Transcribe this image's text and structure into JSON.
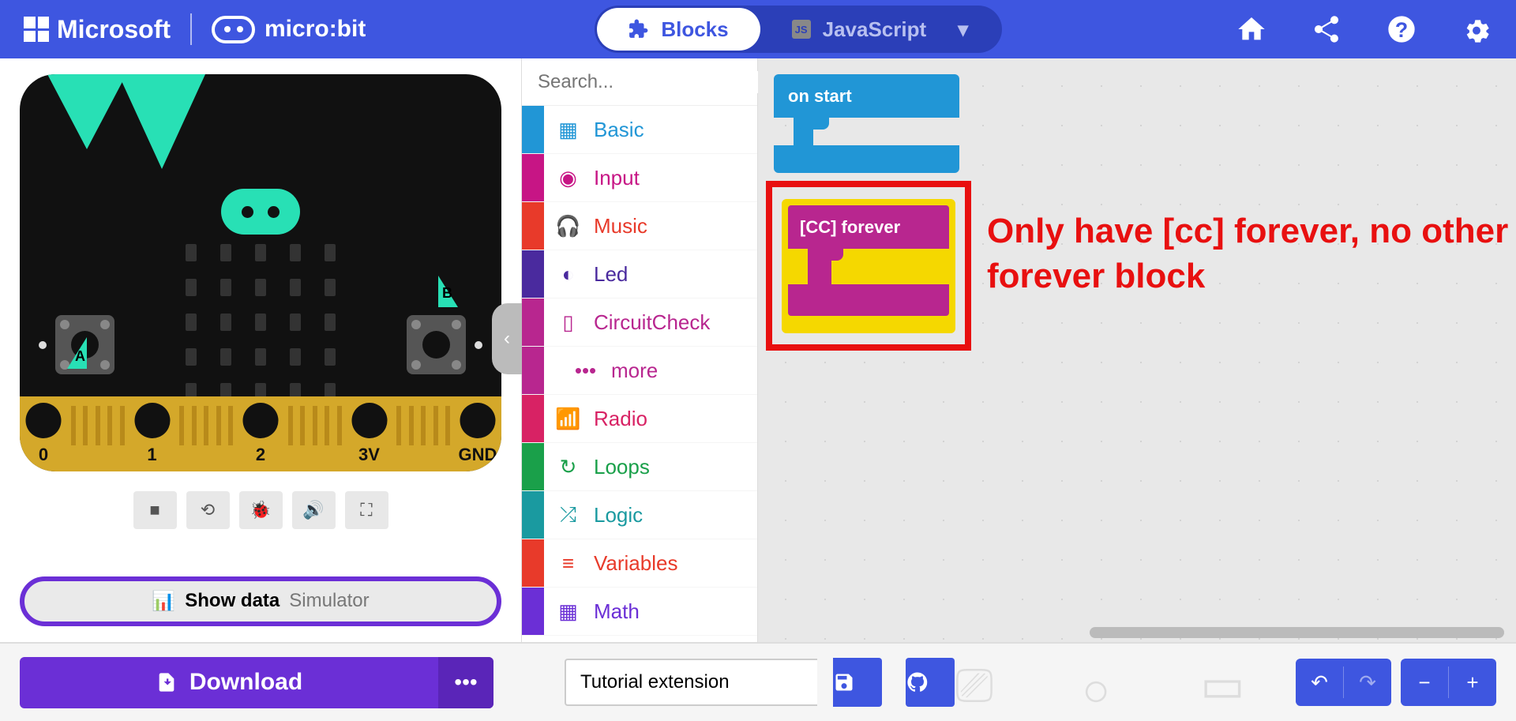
{
  "header": {
    "msLabel": "Microsoft",
    "mbLabel": "micro:bit",
    "tabBlocks": "Blocks",
    "tabJs": "JavaScript"
  },
  "sim": {
    "pin0": "0",
    "pin1": "1",
    "pin2": "2",
    "pin3v": "3V",
    "pinGnd": "GND",
    "labelA": "A",
    "labelB": "B",
    "showDataLabel": "Show data",
    "showDataSub": "Simulator"
  },
  "search": {
    "placeholder": "Search..."
  },
  "categories": [
    {
      "label": "Basic",
      "color": "#2196d6",
      "text": "#2196d6",
      "icon": "grid"
    },
    {
      "label": "Input",
      "color": "#c71585",
      "text": "#c71585",
      "icon": "circle"
    },
    {
      "label": "Music",
      "color": "#e83a2a",
      "text": "#e83a2a",
      "icon": "headphones"
    },
    {
      "label": "Led",
      "color": "#4a2a9e",
      "text": "#4a2a9e",
      "icon": "toggle"
    },
    {
      "label": "CircuitCheck",
      "color": "#b8268f",
      "text": "#b8268f",
      "icon": "chip"
    },
    {
      "label": "more",
      "color": "#b8268f",
      "text": "#b8268f",
      "icon": "dots",
      "indent": true
    },
    {
      "label": "Radio",
      "color": "#d82264",
      "text": "#d82264",
      "icon": "signal"
    },
    {
      "label": "Loops",
      "color": "#1aa04a",
      "text": "#1aa04a",
      "icon": "redo"
    },
    {
      "label": "Logic",
      "color": "#1a9aa0",
      "text": "#1a9aa0",
      "icon": "shuffle"
    },
    {
      "label": "Variables",
      "color": "#e83a2a",
      "text": "#e83a2a",
      "icon": "list"
    },
    {
      "label": "Math",
      "color": "#6b2fd6",
      "text": "#6b2fd6",
      "icon": "calc"
    }
  ],
  "blocks": {
    "onStart": "on start",
    "ccForever": "[CC] forever"
  },
  "annotation": "Only have [cc] forever, no other forever block",
  "footer": {
    "download": "Download",
    "projectName": "Tutorial extension"
  }
}
